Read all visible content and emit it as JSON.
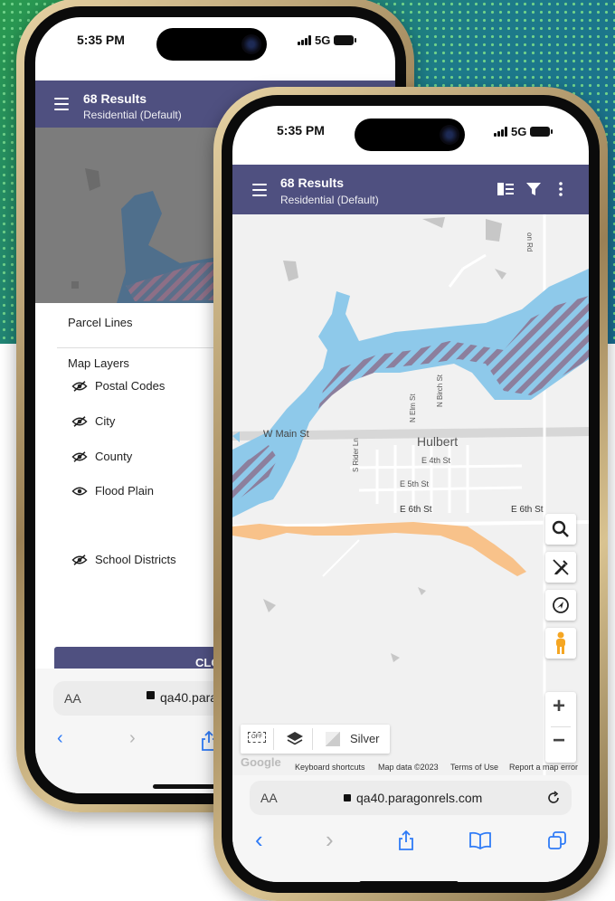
{
  "status": {
    "time": "5:35 PM",
    "network": "5G"
  },
  "header": {
    "title": "68 Results",
    "subtitle": "Residential (Default)"
  },
  "back_sheet": {
    "parcel_lines": "Parcel Lines",
    "map_layers_heading": "Map Layers",
    "layers": [
      {
        "label": "Postal Codes",
        "icon": "eye-off-icon"
      },
      {
        "label": "City",
        "icon": "eye-off-icon"
      },
      {
        "label": "County",
        "icon": "eye-off-icon"
      },
      {
        "label": "Flood Plain",
        "icon": "eye-icon"
      },
      {
        "label": "School Districts",
        "icon": "eye-off-icon"
      }
    ],
    "close_button": "CLO"
  },
  "back_browser": {
    "aa": "AA",
    "url": "qa40.para"
  },
  "front_browser": {
    "aa": "AA",
    "url": "qa40.paragonrels.com"
  },
  "map": {
    "town_label": "Hulbert",
    "streets": {
      "w_main": "W Main St",
      "e_4th": "E 4th St",
      "e_5th": "E 5th St",
      "e_6th_a": "E 6th St",
      "e_6th_b": "E 6th St",
      "s_rider": "S Rider Ln",
      "n_elm": "N Elm St",
      "n_birch": "N Birch St",
      "on_rd": "on Rd"
    },
    "basemap_label": "Silver",
    "toggle_label": "OFF",
    "footer": {
      "google": "Google",
      "shortcuts": "Keyboard shortcuts",
      "map_data": "Map data ©2023",
      "terms": "Terms of Use",
      "report": "Report a map error"
    },
    "zoom_in": "+",
    "zoom_out": "−"
  },
  "colors": {
    "header": "#4f5080",
    "flood": "#8ec9ea",
    "school": "#f8c28a",
    "accent": "#2f7bf6"
  }
}
